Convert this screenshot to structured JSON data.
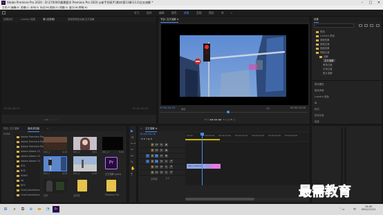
{
  "titlebar": {
    "logo": "Pr",
    "title": "Adobe Premiere Pro 2020 - D:\\170000\\最需要学 Premiere Pro 2020 从新手到高手\\素材\\第13章\\13.2\\交叉溶解 *",
    "min": "–",
    "max": "□",
    "close": "✕"
  },
  "menu": [
    "文件(F)",
    "编辑(E)",
    "剪辑(C)",
    "序列(S)",
    "标记(M)",
    "图形(G)",
    "视图(V)",
    "窗口(W)",
    "帮助(H)"
  ],
  "workspace": {
    "items": [
      "学习",
      "组件",
      "编辑",
      "颜色",
      "效果",
      "音频",
      "图形",
      "库",
      "»"
    ],
    "active_index": 4
  },
  "source_panel": {
    "tabs": [
      "效果控件",
      "Lumetri 范围",
      "源:(无剪辑)",
      "音频剪辑混合器:交叉溶解"
    ],
    "active_tab": 2,
    "timecode": "00;00;00;00",
    "timecode_right": "00;00;00;00"
  },
  "program_panel": {
    "tab": "节目: 交叉溶解 ≡",
    "timecode": "00;00;04;18",
    "fit": "适合",
    "quality": "1/2",
    "duration": "00;00;10;00"
  },
  "effects_panel": {
    "tab": "效果",
    "search_icon": "search-icon",
    "tree": [
      {
        "label": "预设",
        "indent": 0
      },
      {
        "label": "Lumetri 预设",
        "indent": 0
      },
      {
        "label": "音频效果",
        "indent": 0
      },
      {
        "label": "音频过渡",
        "indent": 0
      },
      {
        "label": "视频效果",
        "indent": 0
      },
      {
        "label": "视频过渡",
        "indent": 0
      },
      {
        "label": "溶解",
        "indent": 1
      },
      {
        "label": "交叉溶解",
        "indent": 2,
        "selected": true
      },
      {
        "label": "黑场过渡",
        "indent": 2
      },
      {
        "label": "白场过渡",
        "indent": 2
      },
      {
        "label": "胶片溶解",
        "indent": 2
      }
    ],
    "sections": [
      "基本图形",
      "基本声音",
      "Lumetri 颜色",
      "库",
      "标记",
      "历史记录",
      "信息"
    ]
  },
  "project_panel": {
    "tabs": [
      "项目: 交叉溶解",
      "媒体浏览器",
      "»"
    ],
    "active_tab": 1,
    "drive": "HOME",
    "folders": [
      "Adobe Premiere Pro",
      "Adobe Premiere Pro",
      "Adobe Premiere Pro",
      "adobe-Adobe CS",
      "adobe-Adobe CS",
      "adobe-Adobe CS",
      "RT4",
      "BGE",
      "bilibili",
      "bg",
      "BFX",
      "FineOutlineParts",
      "FineOutlineParts"
    ],
    "items": [
      {
        "name": "001_1",
        "dur": "4;15"
      },
      {
        "name": "001_2",
        "dur": "3;01"
      },
      {
        "name": "001_3",
        "dur": "5;00"
      },
      {
        "name": "001_1",
        "dur": "4;29"
      },
      {
        "name": "001_2",
        "dur": "4;10"
      },
      {
        "name": "交叉溶解.prproj",
        "dur": ""
      },
      {
        "name": "文件",
        "dur": ""
      },
      {
        "name": "文件夹",
        "dur": ""
      },
      {
        "name": "Premiere Pro",
        "dur": ""
      }
    ]
  },
  "timeline_panel": {
    "tab": "交叉溶解 ≡",
    "timecode": "00;00;04;18",
    "ruler": [
      "00;00",
      "00;00;05;00",
      "00;00;10;00",
      "00;00;15;00",
      "00;00;20;00",
      "00;00;25;00",
      "00;00;30;00"
    ],
    "video_tracks": [
      "V3",
      "V2",
      "V1"
    ],
    "audio_tracks": [
      "A1",
      "A2",
      "A3"
    ],
    "master": "主声道",
    "master_value": "0.0",
    "clip_label": "001_1.mp4 [V]"
  },
  "taskbar": {
    "time": "19:45",
    "date": "2021/11/12",
    "lang": "中"
  },
  "watermark": "最需教育",
  "colors": {
    "accent": "#4a8bff",
    "clip_blue": "#8fa7e3",
    "clip_pink": "#e17de0",
    "playhead": "#4a8bff"
  }
}
